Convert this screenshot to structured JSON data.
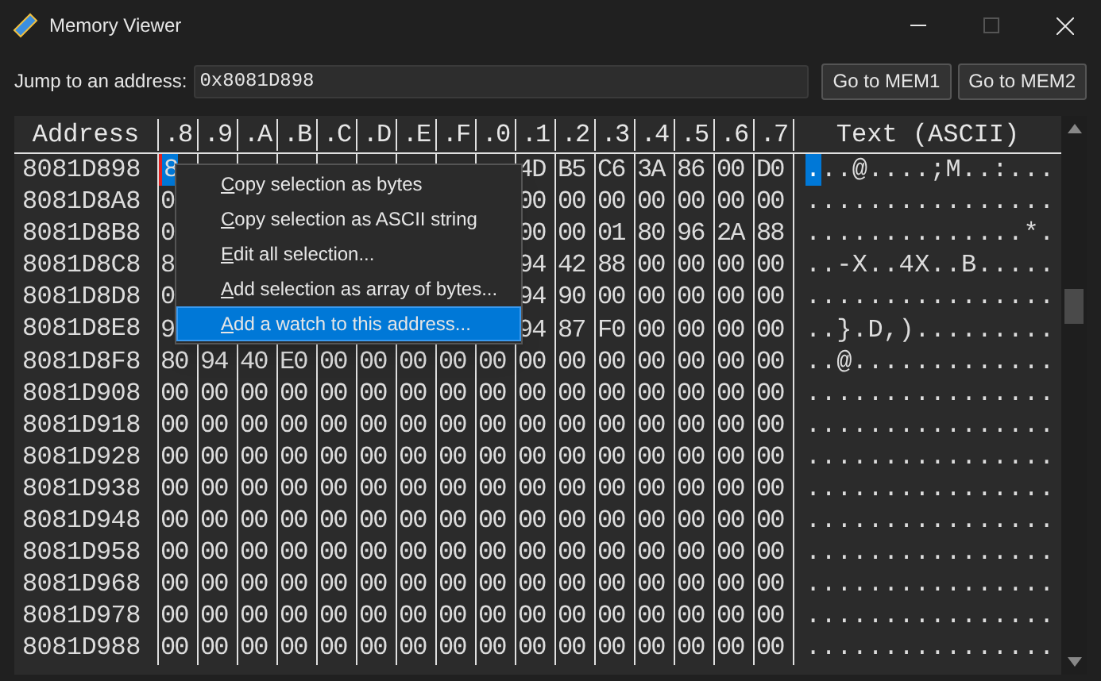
{
  "window": {
    "title": "Memory Viewer",
    "maximize_disabled": true
  },
  "toolbar": {
    "label": "Jump to an address:",
    "address": "0x8081D898",
    "buttons": [
      "Go to MEM1",
      "Go to MEM2"
    ]
  },
  "table": {
    "address_header": "Address",
    "columns": [
      ".8",
      ".9",
      ".A",
      ".B",
      ".C",
      ".D",
      ".E",
      ".F",
      ".0",
      ".1",
      ".2",
      ".3",
      ".4",
      ".5",
      ".6",
      ".7"
    ],
    "text_header": "Text (ASCII)",
    "rows": [
      {
        "address": "8081D898",
        "cells": [
          "8",
          null,
          null,
          null,
          null,
          null,
          null,
          null,
          null,
          "4D",
          "B5",
          "C6",
          "3A",
          "86",
          "00",
          "D0"
        ],
        "ascii_cursor": ".",
        "ascii": "..@....;M..:...",
        "selected": true
      },
      {
        "address": "8081D8A8",
        "cells": [
          "0",
          null,
          null,
          null,
          null,
          null,
          null,
          null,
          null,
          "00",
          "00",
          "00",
          "00",
          "00",
          "00",
          "00"
        ],
        "ascii": "................",
        "selected": false
      },
      {
        "address": "8081D8B8",
        "cells": [
          "0",
          null,
          null,
          null,
          null,
          null,
          null,
          null,
          null,
          "00",
          "00",
          "01",
          "80",
          "96",
          "2A",
          "88"
        ],
        "ascii": "..............*.",
        "selected": false
      },
      {
        "address": "8081D8C8",
        "cells": [
          "8",
          null,
          null,
          null,
          null,
          null,
          null,
          null,
          null,
          "94",
          "42",
          "88",
          "00",
          "00",
          "00",
          "00"
        ],
        "ascii": "..-X..4X..B.....",
        "selected": false
      },
      {
        "address": "8081D8D8",
        "cells": [
          "0",
          null,
          null,
          null,
          null,
          null,
          null,
          null,
          null,
          "94",
          "90",
          "00",
          "00",
          "00",
          "00",
          "00"
        ],
        "ascii": "................",
        "selected": false
      },
      {
        "address": "8081D8E8",
        "cells": [
          "9",
          null,
          null,
          null,
          null,
          null,
          null,
          null,
          null,
          "94",
          "87",
          "F0",
          "00",
          "00",
          "00",
          "00"
        ],
        "ascii": "..}.D,).........",
        "selected": false
      },
      {
        "address": "8081D8F8",
        "cells": [
          "80",
          "94",
          "40",
          "E0",
          "00",
          "00",
          "00",
          "00",
          "00",
          "00",
          "00",
          "00",
          "00",
          "00",
          "00",
          "00"
        ],
        "ascii": "..@.............",
        "selected": false
      },
      {
        "address": "8081D908",
        "cells": [
          "00",
          "00",
          "00",
          "00",
          "00",
          "00",
          "00",
          "00",
          "00",
          "00",
          "00",
          "00",
          "00",
          "00",
          "00",
          "00"
        ],
        "ascii": "................",
        "selected": false
      },
      {
        "address": "8081D918",
        "cells": [
          "00",
          "00",
          "00",
          "00",
          "00",
          "00",
          "00",
          "00",
          "00",
          "00",
          "00",
          "00",
          "00",
          "00",
          "00",
          "00"
        ],
        "ascii": "................",
        "selected": false
      },
      {
        "address": "8081D928",
        "cells": [
          "00",
          "00",
          "00",
          "00",
          "00",
          "00",
          "00",
          "00",
          "00",
          "00",
          "00",
          "00",
          "00",
          "00",
          "00",
          "00"
        ],
        "ascii": "................",
        "selected": false
      },
      {
        "address": "8081D938",
        "cells": [
          "00",
          "00",
          "00",
          "00",
          "00",
          "00",
          "00",
          "00",
          "00",
          "00",
          "00",
          "00",
          "00",
          "00",
          "00",
          "00"
        ],
        "ascii": "................",
        "selected": false
      },
      {
        "address": "8081D948",
        "cells": [
          "00",
          "00",
          "00",
          "00",
          "00",
          "00",
          "00",
          "00",
          "00",
          "00",
          "00",
          "00",
          "00",
          "00",
          "00",
          "00"
        ],
        "ascii": "................",
        "selected": false
      },
      {
        "address": "8081D958",
        "cells": [
          "00",
          "00",
          "00",
          "00",
          "00",
          "00",
          "00",
          "00",
          "00",
          "00",
          "00",
          "00",
          "00",
          "00",
          "00",
          "00"
        ],
        "ascii": "................",
        "selected": false
      },
      {
        "address": "8081D968",
        "cells": [
          "00",
          "00",
          "00",
          "00",
          "00",
          "00",
          "00",
          "00",
          "00",
          "00",
          "00",
          "00",
          "00",
          "00",
          "00",
          "00"
        ],
        "ascii": "................",
        "selected": false
      },
      {
        "address": "8081D978",
        "cells": [
          "00",
          "00",
          "00",
          "00",
          "00",
          "00",
          "00",
          "00",
          "00",
          "00",
          "00",
          "00",
          "00",
          "00",
          "00",
          "00"
        ],
        "ascii": "................",
        "selected": false
      },
      {
        "address": "8081D988",
        "cells": [
          "00",
          "00",
          "00",
          "00",
          "00",
          "00",
          "00",
          "00",
          "00",
          "00",
          "00",
          "00",
          "00",
          "00",
          "00",
          "00"
        ],
        "ascii": "................",
        "selected": false
      }
    ]
  },
  "context_menu": {
    "items": [
      {
        "label": "Copy selection as bytes",
        "underline_first": true,
        "selected": false
      },
      {
        "label": "Copy selection as ASCII string",
        "underline_first": true,
        "selected": false
      },
      {
        "label": "Edit all selection...",
        "underline_first": true,
        "selected": false
      },
      {
        "label": "Add selection as array of bytes...",
        "underline_first": true,
        "selected": false
      },
      {
        "label": "Add a watch to this address...",
        "underline_first": true,
        "selected": true
      }
    ]
  }
}
